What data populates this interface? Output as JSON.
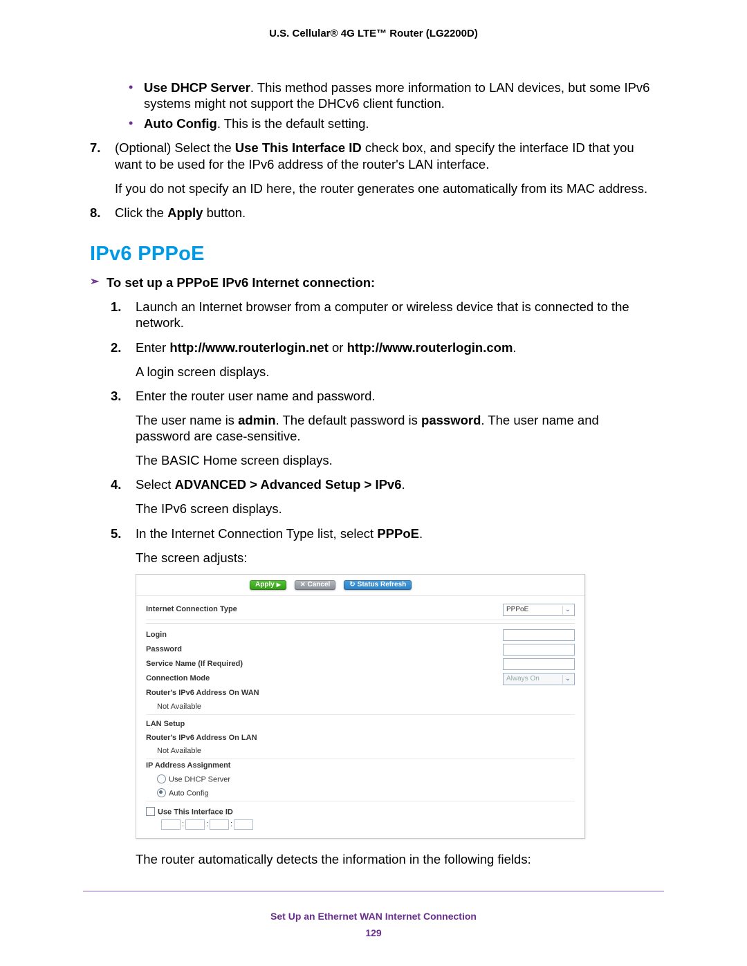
{
  "header": "U.S. Cellular® 4G LTE™ Router (LG2200D)",
  "body": {
    "bullets": [
      {
        "bold": "Use DHCP Server",
        "rest": ". This method passes more information to LAN devices, but some IPv6 systems might not support the DHCv6 client function."
      },
      {
        "bold": "Auto Config",
        "rest": ". This is the default setting."
      }
    ],
    "step7_num": "7.",
    "step7_a": "(Optional) Select the ",
    "step7_bold": "Use This Interface ID",
    "step7_b": " check box, and specify the interface ID that you want to be used for the IPv6 address of the router's LAN interface.",
    "step7_p2": "If you do not specify an ID here, the router generates one automatically from its MAC address.",
    "step8_num": "8.",
    "step8_a": "Click the ",
    "step8_bold": "Apply",
    "step8_b": " button."
  },
  "heading": "IPv6 PPPoE",
  "intro": "To set up a PPPoE IPv6 Internet connection:",
  "steps": {
    "n1": "1.",
    "t1": "Launch an Internet browser from a computer or wireless device that is connected to the network.",
    "n2": "2.",
    "t2a": "Enter ",
    "t2b": "http://www.routerlogin.net",
    "t2c": " or ",
    "t2d": "http://www.routerlogin.com",
    "t2e": ".",
    "t2p": "A login screen displays.",
    "n3": "3.",
    "t3": "Enter the router user name and password.",
    "t3pa": "The user name is ",
    "t3pb": "admin",
    "t3pc": ". The default password is ",
    "t3pd": "password",
    "t3pe": ". The user name and password are case-sensitive.",
    "t3p2": "The BASIC Home screen displays.",
    "n4": "4.",
    "t4a": "Select ",
    "t4b": "ADVANCED > Advanced Setup > IPv6",
    "t4c": ".",
    "t4p": "The IPv6 screen displays.",
    "n5": "5.",
    "t5a": "In the Internet Connection Type list, select ",
    "t5b": "PPPoE",
    "t5c": ".",
    "t5p": "The screen adjusts:"
  },
  "screenshot": {
    "btn_apply": "Apply",
    "btn_cancel": "Cancel",
    "btn_refresh": "Status Refresh",
    "rows": {
      "ict": "Internet Connection Type",
      "ict_val": "PPPoE",
      "login": "Login",
      "password": "Password",
      "service": "Service Name (If Required)",
      "connmode": "Connection Mode",
      "connmode_val": "Always On",
      "wan_addr": "Router's IPv6 Address On WAN",
      "na": "Not Available",
      "lan_setup": "LAN Setup",
      "lan_addr": "Router's IPv6 Address On LAN",
      "ip_assign": "IP Address Assignment",
      "use_dhcp": "Use DHCP Server",
      "auto_cfg": "Auto Config",
      "use_iface": "Use This Interface ID"
    }
  },
  "after_ss": "The router automatically detects the information in the following fields:",
  "footer_title": "Set Up an Ethernet WAN Internet Connection",
  "footer_page": "129"
}
